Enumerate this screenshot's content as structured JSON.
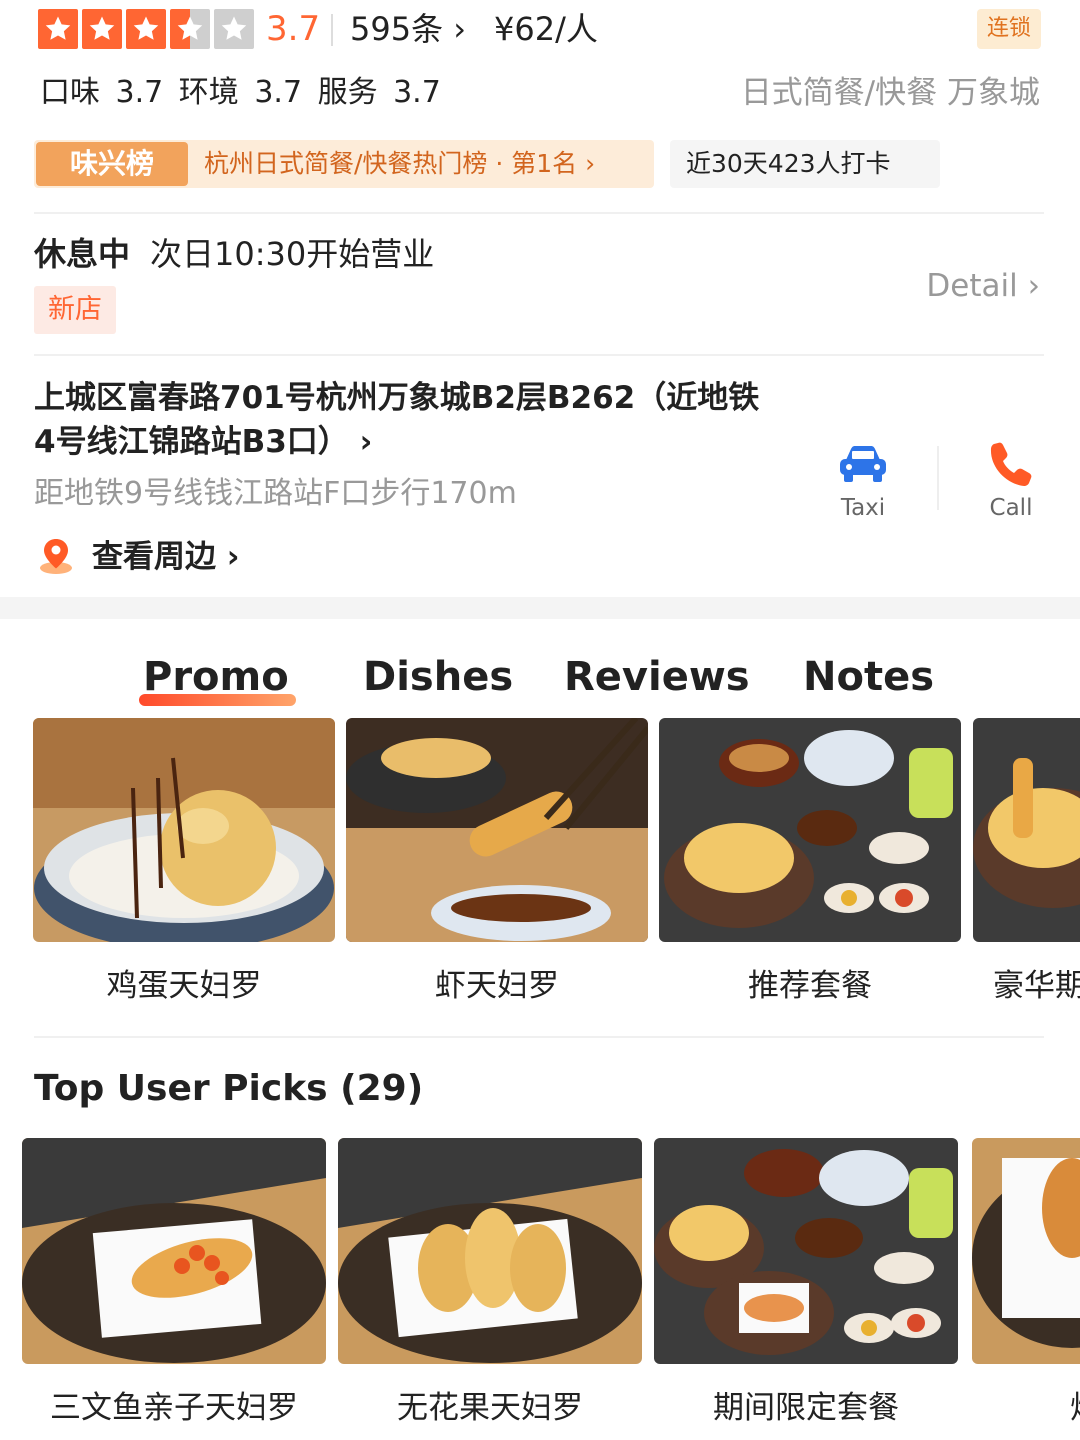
{
  "header": {
    "rating": "3.7",
    "stars_filled": 3.5,
    "stars_total": 5,
    "reviews": "595条",
    "price": "¥62/人",
    "chain_badge": "连锁",
    "scores": "口味 3.7  环境 3.7  服务 3.7",
    "category": "日式简餐/快餐  万象城"
  },
  "ranking": {
    "logo_text": "味兴榜",
    "text": "杭州日式简餐/快餐热门榜 · 第1名",
    "checkin": "近30天423人打卡"
  },
  "hours": {
    "status": "休息中",
    "next_open": "次日10:30开始营业",
    "new_tag": "新店",
    "detail_label": "Detail"
  },
  "location": {
    "address": "上城区富春路701号杭州万象城B2层B262（近地铁4号线江锦路站B3口）",
    "subway": "距地铁9号线钱江路站F口步行170m",
    "nearby": "查看周边",
    "taxi_label": "Taxi",
    "call_label": "Call"
  },
  "tabs": [
    "Promo",
    "Dishes",
    "Reviews",
    "Notes"
  ],
  "promo_dishes": [
    "鸡蛋天妇罗",
    "虾天妇罗",
    "推荐套餐",
    "豪华期"
  ],
  "top_picks": {
    "title": "Top User Picks (29)",
    "items": [
      "三文鱼亲子天妇罗",
      "无花果天妇罗",
      "期间限定套餐",
      "炸"
    ]
  },
  "colors": {
    "accent": "#ff6633",
    "rank_text": "#d2651e",
    "muted": "#999999"
  }
}
